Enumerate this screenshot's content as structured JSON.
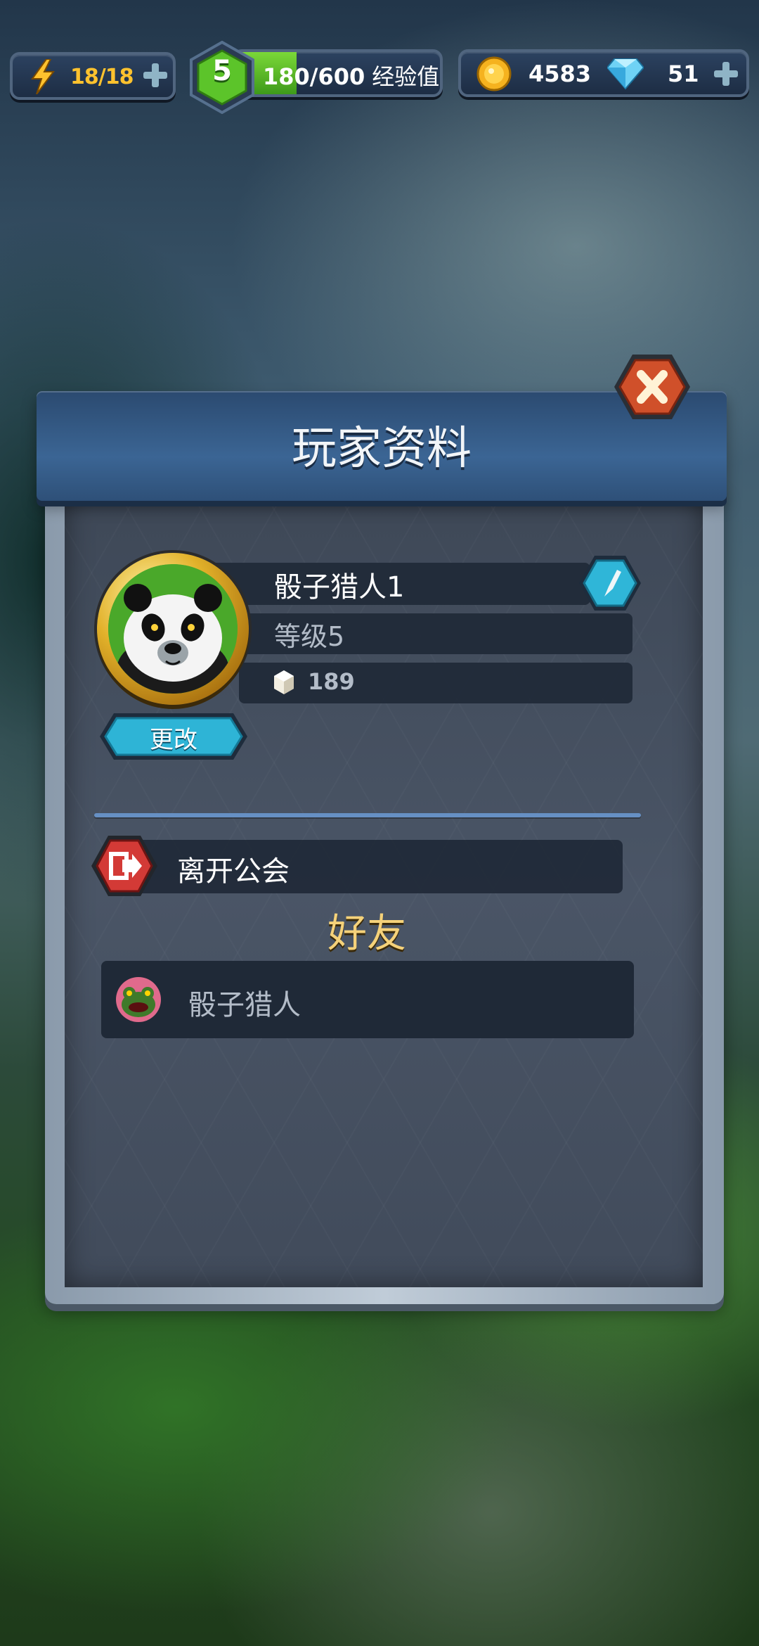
{
  "hud": {
    "energy": "18/18",
    "level": "5",
    "xp_value": "180/600",
    "xp_label": "经验值",
    "xp_progress": 0.3,
    "coins": "4583",
    "gems": "51"
  },
  "panel": {
    "title": "玩家资料",
    "player_name": "骰子猎人1",
    "level_text": "等级5",
    "stat_value": "189",
    "change_label": "更改",
    "leave_guild_label": "离开公会",
    "friends_title": "好友",
    "friends": [
      {
        "name": "骰子猎人"
      }
    ]
  },
  "icons": {
    "energy": "lightning-bolt-icon",
    "coin": "gold-coin-icon",
    "gem": "diamond-icon",
    "close": "close-x-icon",
    "edit": "pencil-icon",
    "leave": "exit-door-icon",
    "stat": "white-cube-icon"
  }
}
